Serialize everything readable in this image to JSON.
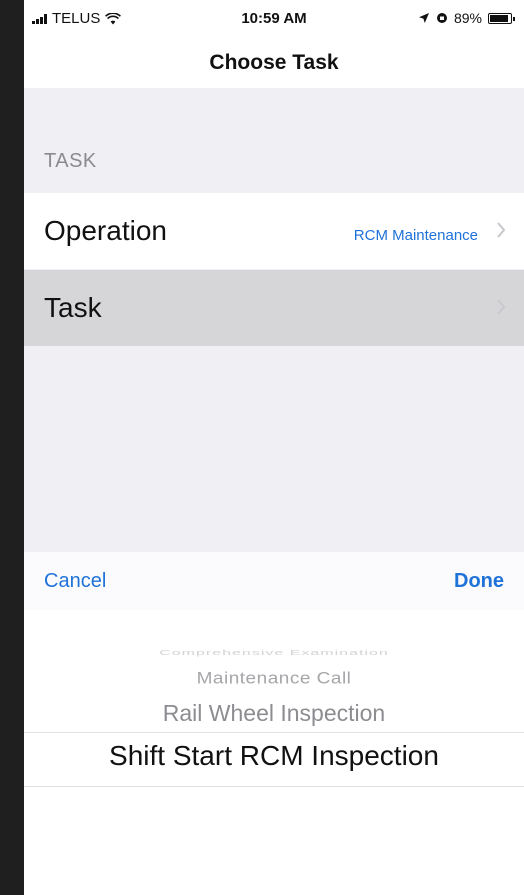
{
  "status_bar": {
    "carrier": "TELUS",
    "time": "10:59 AM",
    "battery": "89%",
    "battery_level": 0.89
  },
  "nav": {
    "title": "Choose Task"
  },
  "form": {
    "section_header": "TASK",
    "rows": [
      {
        "label": "Operation",
        "value": "RCM Maintenance"
      },
      {
        "label": "Task",
        "value": ""
      }
    ]
  },
  "picker": {
    "cancel_label": "Cancel",
    "done_label": "Done",
    "options": [
      "Comprehensive Examination",
      "Maintenance Call",
      "Rail Wheel Inspection",
      "Shift Start RCM Inspection"
    ],
    "selected": "Shift Start RCM Inspection"
  },
  "colors": {
    "accent": "#1e72d8",
    "background": "#efeff4",
    "selected_row": "#d6d6d9"
  },
  "icons": [
    "signal-icon",
    "wifi-icon",
    "location-arrow-icon",
    "lock-rotation-icon",
    "battery-icon",
    "chevron-right-icon"
  ]
}
